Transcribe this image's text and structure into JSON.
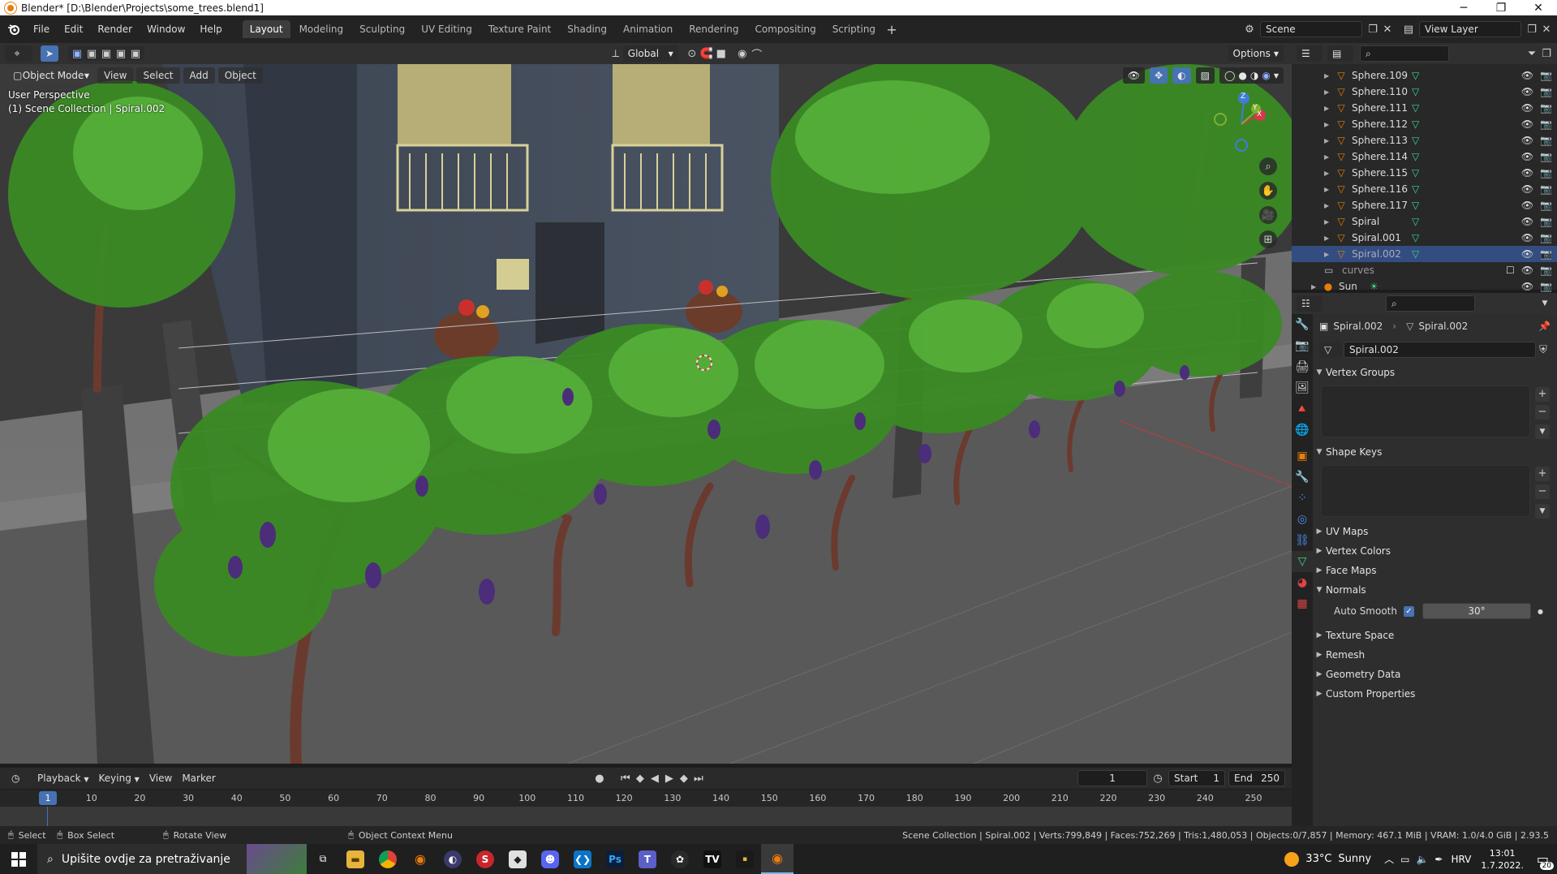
{
  "window": {
    "title": "Blender* [D:\\Blender\\Projects\\some_trees.blend1]",
    "controls": [
      "─",
      "❐",
      "✕"
    ]
  },
  "menus": [
    "File",
    "Edit",
    "Render",
    "Window",
    "Help"
  ],
  "workspaces": [
    "Layout",
    "Modeling",
    "Sculpting",
    "UV Editing",
    "Texture Paint",
    "Shading",
    "Animation",
    "Rendering",
    "Compositing",
    "Scripting"
  ],
  "active_workspace": "Layout",
  "scene": {
    "name": "Scene",
    "view_layer": "View Layer"
  },
  "viewport": {
    "transform_orientation": "Global",
    "options_label": "Options",
    "mode": "Object Mode",
    "header_menus": [
      "View",
      "Select",
      "Add",
      "Object"
    ],
    "overlay_line1": "User Perspective",
    "overlay_line2": "(1) Scene Collection | Spiral.002",
    "gizmo_axes": {
      "x": "X",
      "y": "Y",
      "z": "Z"
    }
  },
  "outliner": {
    "rows": [
      {
        "name": "Sphere.109",
        "selected": false
      },
      {
        "name": "Sphere.110",
        "selected": false
      },
      {
        "name": "Sphere.111",
        "selected": false
      },
      {
        "name": "Sphere.112",
        "selected": false
      },
      {
        "name": "Sphere.113",
        "selected": false
      },
      {
        "name": "Sphere.114",
        "selected": false
      },
      {
        "name": "Sphere.115",
        "selected": false
      },
      {
        "name": "Sphere.116",
        "selected": false
      },
      {
        "name": "Sphere.117",
        "selected": false
      },
      {
        "name": "Spiral",
        "selected": false
      },
      {
        "name": "Spiral.001",
        "selected": false
      },
      {
        "name": "Spiral.002",
        "selected": true
      }
    ],
    "collection": "curves",
    "light": "Sun"
  },
  "properties": {
    "breadcrumb_object": "Spiral.002",
    "breadcrumb_data": "Spiral.002",
    "datablock": "Spiral.002",
    "panels": {
      "vertex_groups": "Vertex Groups",
      "shape_keys": "Shape Keys",
      "uv_maps": "UV Maps",
      "vertex_colors": "Vertex Colors",
      "face_maps": "Face Maps",
      "normals": "Normals",
      "auto_smooth_label": "Auto Smooth",
      "auto_smooth_angle": "30°",
      "texture_space": "Texture Space",
      "remesh": "Remesh",
      "geometry_data": "Geometry Data",
      "custom_properties": "Custom Properties"
    }
  },
  "timeline": {
    "menus": [
      "Playback",
      "Keying",
      "View",
      "Marker"
    ],
    "current_frame": "1",
    "start_label": "Start",
    "start": "1",
    "end_label": "End",
    "end": "250",
    "ticks": [
      "1",
      "10",
      "20",
      "30",
      "40",
      "50",
      "60",
      "70",
      "80",
      "90",
      "100",
      "110",
      "120",
      "130",
      "140",
      "150",
      "160",
      "170",
      "180",
      "190",
      "200",
      "210",
      "220",
      "230",
      "240",
      "250"
    ]
  },
  "statusbar": {
    "select": "Select",
    "box_select": "Box Select",
    "rotate_view": "Rotate View",
    "context_menu": "Object Context Menu",
    "stats": "Scene Collection | Spiral.002 | Verts:799,849 | Faces:752,269 | Tris:1,480,053 | Objects:0/7,857 | Memory: 467.1 MiB | VRAM: 1.0/4.0 GiB | 2.93.5"
  },
  "taskbar": {
    "search_placeholder": "Upišite ovdje za pretraživanje",
    "weather_temp": "33°C",
    "weather_text": "Sunny",
    "language": "HRV",
    "time": "13:01",
    "date": "1.7.2022.",
    "notifications": "20"
  },
  "colors": {
    "accent": "#4772b3",
    "selection": "#334d80",
    "blender_orange": "#e87d0d"
  }
}
